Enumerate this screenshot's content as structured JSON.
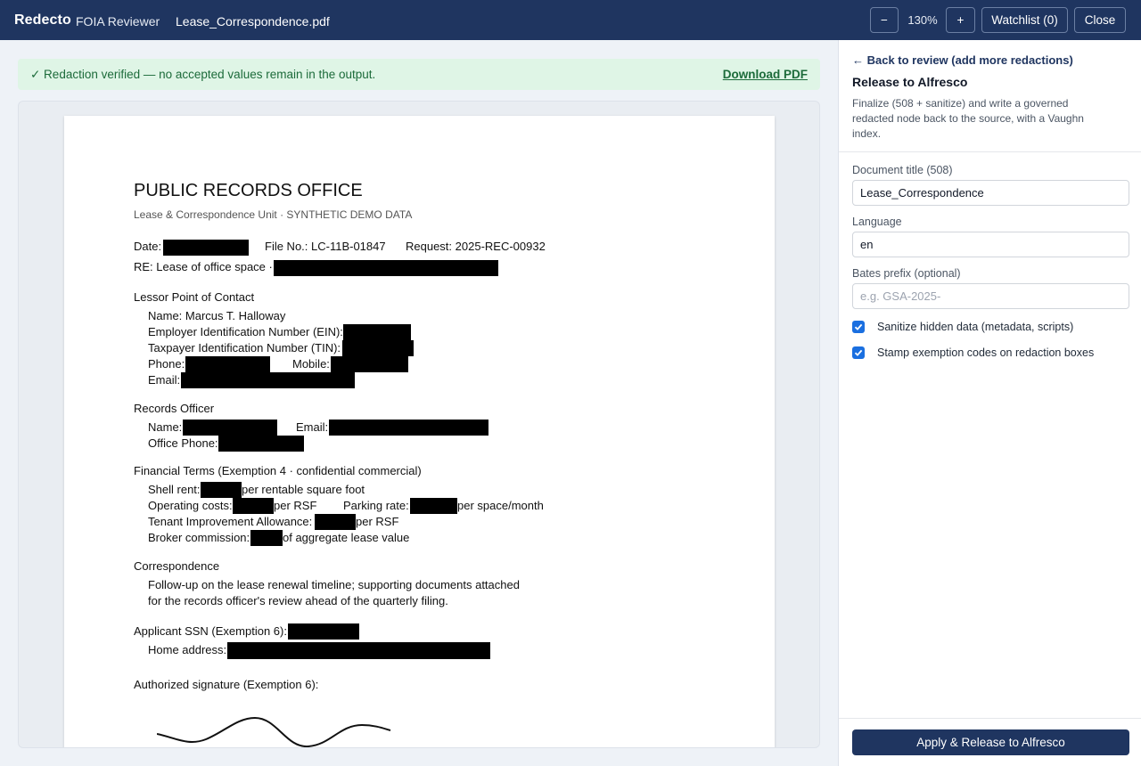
{
  "topbar": {
    "brand": "Redecto",
    "product": "FOIA Reviewer",
    "filename": "Lease_Correspondence.pdf",
    "zoom_out_label": "−",
    "zoom_level": "130%",
    "zoom_in_label": "+",
    "watchlist_label": "Watchlist (0)",
    "close_label": "Close"
  },
  "banner": {
    "message": "✓ Redaction verified — no accepted values remain in the output.",
    "download_label": "Download PDF"
  },
  "document": {
    "title": "PUBLIC RECORDS OFFICE",
    "subtitle": "Lease & Correspondence Unit  ·  SYNTHETIC DEMO DATA",
    "date_label": "Date:",
    "file_no": "File No.: LC-11B-01847",
    "request": "Request: 2025-REC-00932",
    "re_line": "RE: Lease of office space ·",
    "lessor_heading": "Lessor Point of Contact",
    "lessor_name": "Name: Marcus T. Halloway",
    "ein_label": "Employer Identification Number (EIN):",
    "tin_label": "Taxpayer Identification Number (TIN):",
    "phone_label": "Phone:",
    "mobile_label": "Mobile:",
    "email_label": "Email:",
    "records_heading": "Records Officer",
    "ro_name_label": "Name:",
    "ro_email_label": "Email:",
    "ro_phone_label": "Office Phone:",
    "financial_heading": "Financial Terms (Exemption 4 · confidential commercial)",
    "shell_rent_label": "Shell rent:",
    "shell_rent_suffix": "per rentable square foot",
    "opcost_label": "Operating costs:",
    "opcost_suffix": "per RSF",
    "parking_label": "Parking rate:",
    "parking_suffix": "per space/month",
    "tia_label": "Tenant Improvement Allowance:",
    "tia_suffix": "per RSF",
    "broker_label": "Broker commission:",
    "broker_suffix": "of aggregate lease value",
    "corr_heading": "Correspondence",
    "corr_line1": "Follow-up on the lease renewal timeline; supporting documents attached",
    "corr_line2": "for the records officer's review ahead of the quarterly filing.",
    "ssn_label": "Applicant SSN (Exemption 6):",
    "home_label": "Home address:",
    "signature_label": "Authorized signature (Exemption 6):"
  },
  "panel": {
    "back_link": "← Back to review (add more redactions)",
    "title": "Release to Alfresco",
    "description": "Finalize (508 + sanitize) and write a governed redacted node back to the source, with a Vaughn index.",
    "doc_title_label": "Document title (508)",
    "doc_title_value": "Lease_Correspondence",
    "language_label": "Language",
    "language_value": "en",
    "bates_label": "Bates prefix (optional)",
    "bates_placeholder": "e.g. GSA-2025-",
    "bates_value": "",
    "sanitize_label": "Sanitize hidden data (metadata, scripts)",
    "sanitize_checked": true,
    "stamp_label": "Stamp exemption codes on redaction boxes",
    "stamp_checked": true,
    "apply_label": "Apply & Release to Alfresco"
  },
  "colors": {
    "topbar_bg": "#1f3560",
    "banner_bg": "#dff5e6",
    "banner_text": "#1c6b3a",
    "checkbox": "#1a6fe0",
    "primary_button": "#1f3560"
  }
}
